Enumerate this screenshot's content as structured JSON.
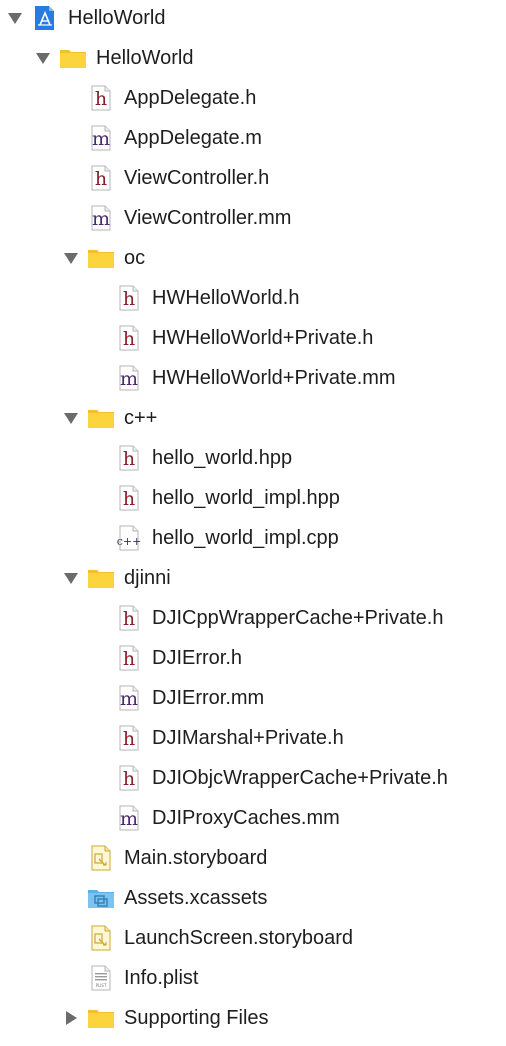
{
  "navigator": {
    "items": [
      {
        "label": "HelloWorld",
        "kind": "project",
        "depth": 0,
        "disclosure": "expanded"
      },
      {
        "label": "HelloWorld",
        "kind": "folder",
        "depth": 1,
        "disclosure": "expanded"
      },
      {
        "label": "AppDelegate.h",
        "kind": "h",
        "depth": 2,
        "disclosure": "none"
      },
      {
        "label": "AppDelegate.m",
        "kind": "m",
        "depth": 2,
        "disclosure": "none"
      },
      {
        "label": "ViewController.h",
        "kind": "h",
        "depth": 2,
        "disclosure": "none"
      },
      {
        "label": "ViewController.mm",
        "kind": "m",
        "depth": 2,
        "disclosure": "none"
      },
      {
        "label": "oc",
        "kind": "folder",
        "depth": 2,
        "disclosure": "expanded"
      },
      {
        "label": "HWHelloWorld.h",
        "kind": "h",
        "depth": 3,
        "disclosure": "none"
      },
      {
        "label": "HWHelloWorld+Private.h",
        "kind": "h",
        "depth": 3,
        "disclosure": "none"
      },
      {
        "label": "HWHelloWorld+Private.mm",
        "kind": "m",
        "depth": 3,
        "disclosure": "none"
      },
      {
        "label": "c++",
        "kind": "folder",
        "depth": 2,
        "disclosure": "expanded"
      },
      {
        "label": "hello_world.hpp",
        "kind": "h",
        "depth": 3,
        "disclosure": "none"
      },
      {
        "label": "hello_world_impl.hpp",
        "kind": "h",
        "depth": 3,
        "disclosure": "none"
      },
      {
        "label": "hello_world_impl.cpp",
        "kind": "cpp",
        "depth": 3,
        "disclosure": "none"
      },
      {
        "label": "djinni",
        "kind": "folder",
        "depth": 2,
        "disclosure": "expanded"
      },
      {
        "label": "DJICppWrapperCache+Private.h",
        "kind": "h",
        "depth": 3,
        "disclosure": "none"
      },
      {
        "label": "DJIError.h",
        "kind": "h",
        "depth": 3,
        "disclosure": "none"
      },
      {
        "label": "DJIError.mm",
        "kind": "m",
        "depth": 3,
        "disclosure": "none"
      },
      {
        "label": "DJIMarshal+Private.h",
        "kind": "h",
        "depth": 3,
        "disclosure": "none"
      },
      {
        "label": "DJIObjcWrapperCache+Private.h",
        "kind": "h",
        "depth": 3,
        "disclosure": "none"
      },
      {
        "label": "DJIProxyCaches.mm",
        "kind": "m",
        "depth": 3,
        "disclosure": "none"
      },
      {
        "label": "Main.storyboard",
        "kind": "storyboard",
        "depth": 2,
        "disclosure": "none"
      },
      {
        "label": "Assets.xcassets",
        "kind": "assets",
        "depth": 2,
        "disclosure": "none"
      },
      {
        "label": "LaunchScreen.storyboard",
        "kind": "storyboard",
        "depth": 2,
        "disclosure": "none"
      },
      {
        "label": "Info.plist",
        "kind": "plist",
        "depth": 2,
        "disclosure": "none"
      },
      {
        "label": "Supporting Files",
        "kind": "folder",
        "depth": 2,
        "disclosure": "collapsed"
      }
    ],
    "icon_glyphs": {
      "h": "h",
      "m": "m",
      "cpp": "c++",
      "plist": "PLIST"
    }
  },
  "colors": {
    "h_glyph": "#8a1c2b",
    "m_glyph": "#4a2a6b",
    "cpp_glyph": "#3a2a5b",
    "folder_fill": "#fcd43e",
    "folder_tab": "#f0c22a",
    "assets_fill": "#7cc3ef",
    "project_blue": "#2a7be0",
    "disclosure": "#6b6b6b"
  }
}
